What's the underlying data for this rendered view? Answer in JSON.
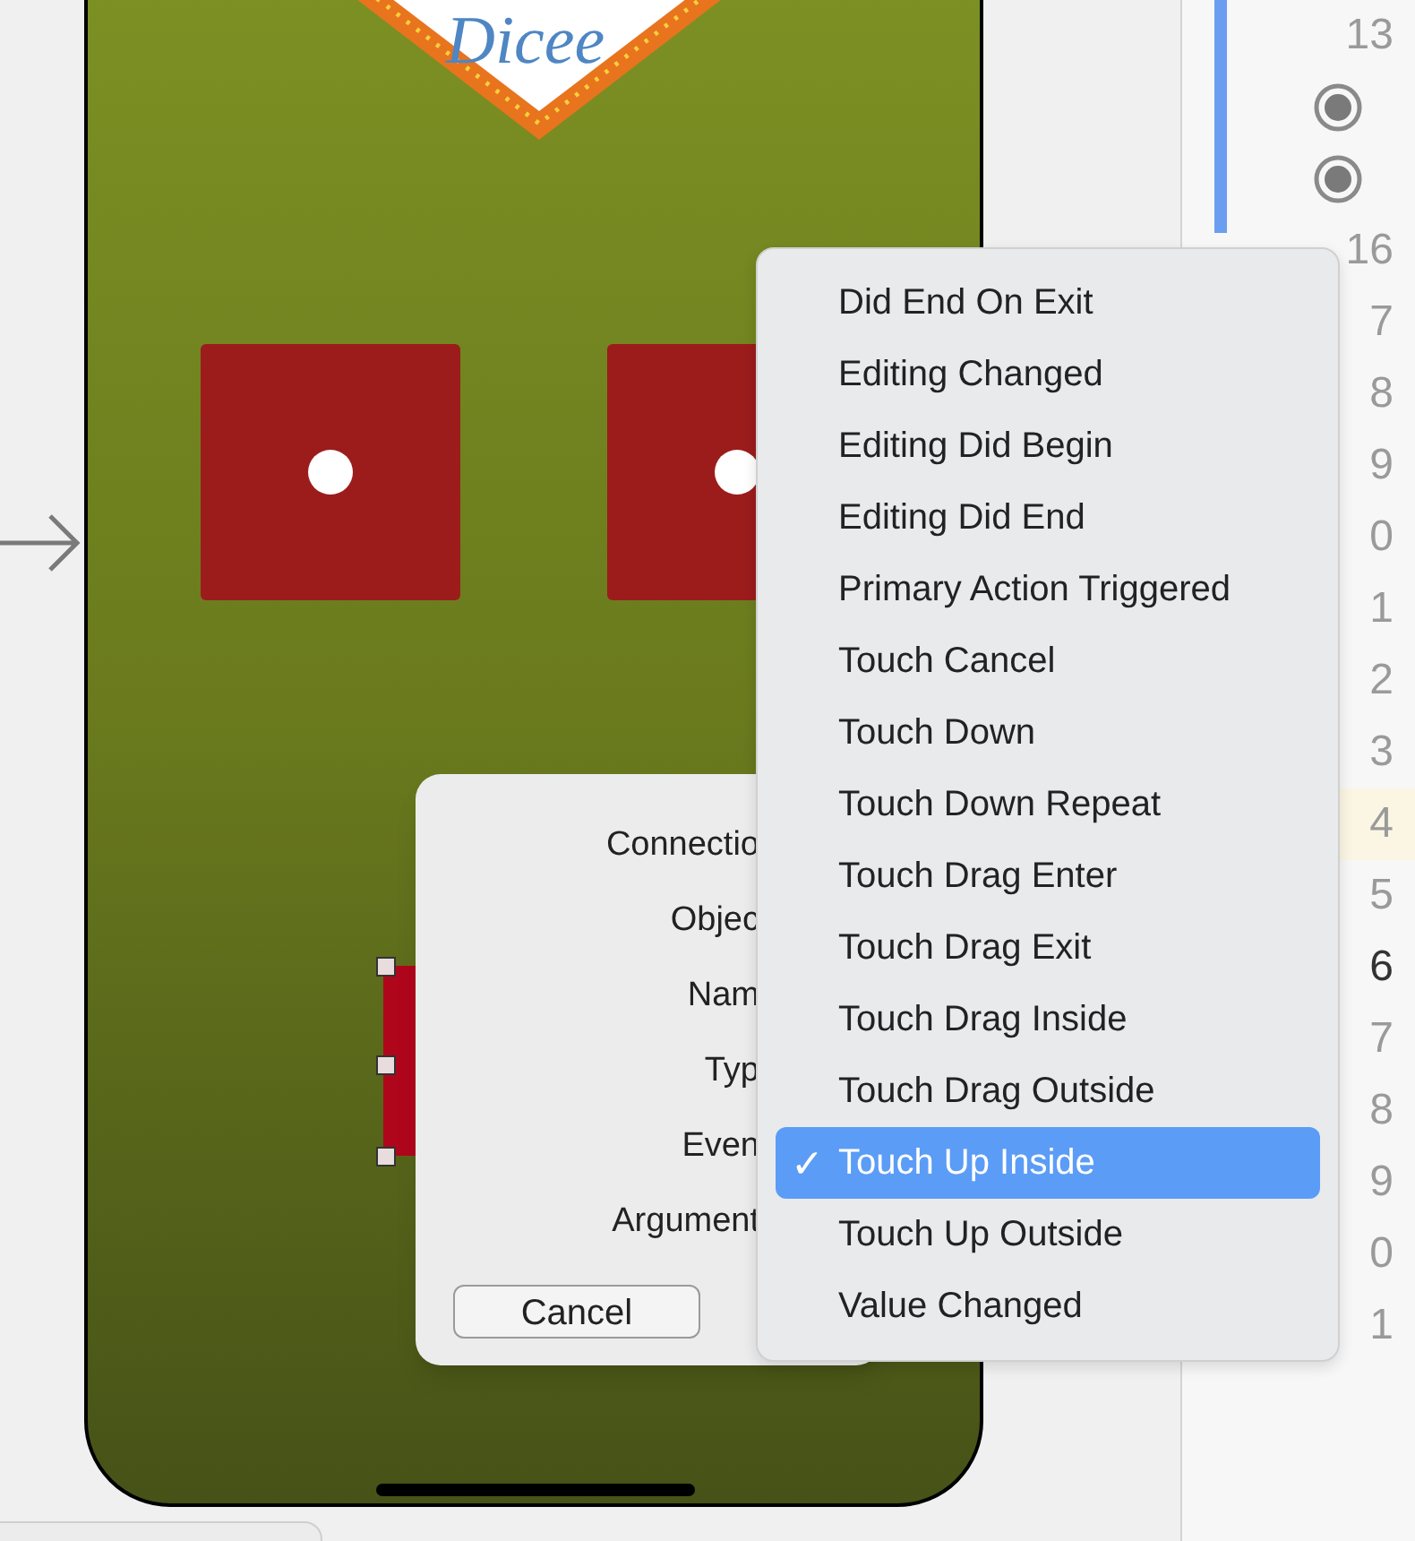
{
  "storyboard": {
    "logo": {
      "text": "Dicee"
    },
    "dice": [
      {
        "kind": "one"
      },
      {
        "kind": "one"
      }
    ]
  },
  "connection_dialog": {
    "labels": [
      "Connectio",
      "Objec",
      "Nam",
      "Typ",
      "Even",
      "Argument"
    ],
    "cancel_button": "Cancel"
  },
  "event_menu": {
    "items": [
      {
        "label": "Did End On Exit",
        "selected": false
      },
      {
        "label": "Editing Changed",
        "selected": false
      },
      {
        "label": "Editing Did Begin",
        "selected": false
      },
      {
        "label": "Editing Did End",
        "selected": false
      },
      {
        "label": "Primary Action Triggered",
        "selected": false
      },
      {
        "label": "Touch Cancel",
        "selected": false
      },
      {
        "label": "Touch Down",
        "selected": false
      },
      {
        "label": "Touch Down Repeat",
        "selected": false
      },
      {
        "label": "Touch Drag Enter",
        "selected": false
      },
      {
        "label": "Touch Drag Exit",
        "selected": false
      },
      {
        "label": "Touch Drag Inside",
        "selected": false
      },
      {
        "label": "Touch Drag Outside",
        "selected": false
      },
      {
        "label": "Touch Up Inside",
        "selected": true
      },
      {
        "label": "Touch Up Outside",
        "selected": false
      },
      {
        "label": "Value Changed",
        "selected": false
      }
    ],
    "check_mark": "✓"
  },
  "gutter": {
    "lines": [
      {
        "kind": "number",
        "text": "13",
        "highlighted": false
      },
      {
        "kind": "breakpoint",
        "highlighted": false
      },
      {
        "kind": "breakpoint",
        "highlighted": false
      },
      {
        "kind": "number",
        "text": "16",
        "highlighted": false
      },
      {
        "kind": "number",
        "text": "7",
        "highlighted": false
      },
      {
        "kind": "number",
        "text": "8",
        "highlighted": false
      },
      {
        "kind": "number",
        "text": "9",
        "highlighted": false
      },
      {
        "kind": "number",
        "text": "0",
        "highlighted": false
      },
      {
        "kind": "number",
        "text": "1",
        "highlighted": false
      },
      {
        "kind": "number",
        "text": "2",
        "highlighted": false
      },
      {
        "kind": "number",
        "text": "3",
        "highlighted": false
      },
      {
        "kind": "number",
        "text": "4",
        "highlighted": true
      },
      {
        "kind": "number",
        "text": "5",
        "highlighted": false
      },
      {
        "kind": "number",
        "text": "6",
        "highlighted": false
      },
      {
        "kind": "number",
        "text": "7",
        "highlighted": false
      },
      {
        "kind": "number",
        "text": "8",
        "highlighted": false
      },
      {
        "kind": "number",
        "text": "9",
        "highlighted": false
      },
      {
        "kind": "number",
        "text": "0",
        "highlighted": false
      },
      {
        "kind": "number",
        "text": "1",
        "highlighted": false
      }
    ]
  }
}
